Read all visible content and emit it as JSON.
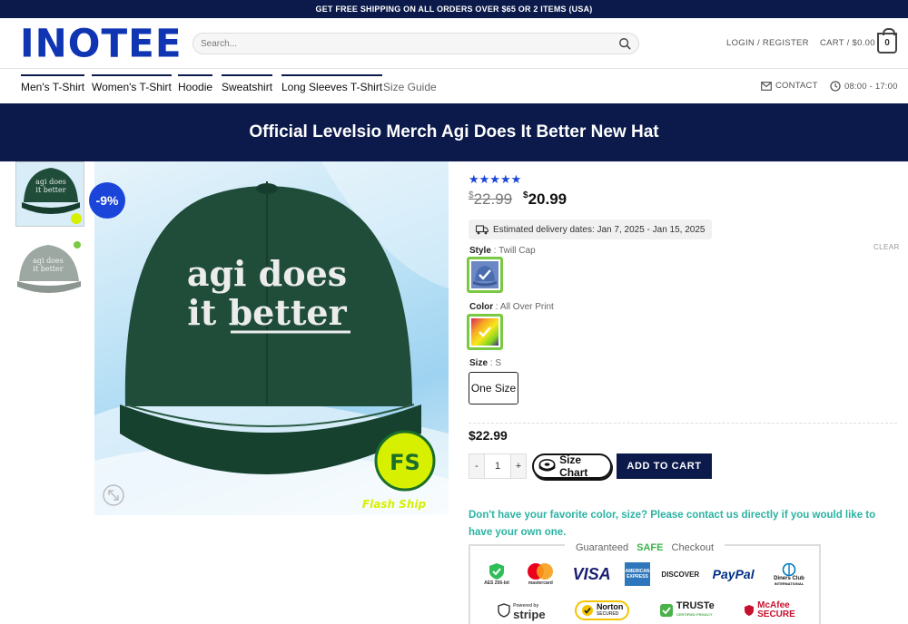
{
  "topbar": {
    "text": "GET FREE SHIPPING ON ALL ORDERS OVER $65 OR 2 ITEMS (USA)"
  },
  "header": {
    "logo": "INOTEE",
    "search_placeholder": "Search...",
    "login": "LOGIN / REGISTER",
    "cart_label": "CART / $0.00",
    "cart_count": "0"
  },
  "nav": {
    "items": [
      {
        "label": "Men's T-Shirt"
      },
      {
        "label": "Women's T-Shirt"
      },
      {
        "label": "Hoodie"
      },
      {
        "label": "Sweatshirt"
      },
      {
        "label": "Long Sleeves T-Shirt"
      },
      {
        "label": "Size Guide"
      }
    ],
    "contact": "CONTACT",
    "hours": "08:00 - 17:00"
  },
  "product": {
    "title": "Official Levelsio Merch Agi Does It Better New Hat",
    "hat_text_line1": "agi does",
    "hat_text_line2": "it better",
    "discount": "-9%",
    "rating_stars": 5,
    "old_price_symbol": "$",
    "old_price": "22.99",
    "new_price_symbol": "$",
    "new_price": "20.99",
    "delivery": "Estimated delivery dates: Jan 7, 2025 - Jan 15, 2025",
    "clear": "CLEAR",
    "style_label": "Style",
    "style_value": "Twill Cap",
    "color_label": "Color",
    "color_value": "All Over Print",
    "size_label": "Size",
    "size_value": "S",
    "size_option": "One Size",
    "variant_price": "$22.99",
    "qty_minus": "-",
    "qty": "1",
    "qty_plus": "+",
    "size_chart": "Size Chart",
    "add_to_cart": "ADD TO CART",
    "contact_note": "Don't have your favorite color, size? Please contact us directly if you would like to have your own one.",
    "flash_text": "Flash Ship",
    "flash_badge": "FS"
  },
  "checkout": {
    "title_prefix": "Guaranteed",
    "title_safe": "SAFE",
    "title_suffix": "Checkout",
    "row1": {
      "aes": "AES 256-bit",
      "mastercard": "mastercard",
      "visa": "VISA",
      "amex": "AMERICAN EXPRESS",
      "discover": "DISCOVER",
      "paypal": "PayPal",
      "diners": "Diners Club",
      "diners_sub": "INTERNATIONAL"
    },
    "row2": {
      "stripe_top": "Powered by",
      "stripe": "stripe",
      "norton": "Norton",
      "norton_sub": "SECURED",
      "truste": "TRUSTe",
      "truste_sub": "CERTIFIED PRIVACY",
      "mcafee": "McAfee",
      "mcafee_sub": "SECURE"
    }
  },
  "colors": {
    "navy": "#0b1a4a",
    "brand_blue": "#1035b3",
    "badge_blue": "#1b45d9",
    "hat_green": "#1f4d3a",
    "swatch_green": "#7ac943",
    "teal_text": "#2bb3a3"
  }
}
